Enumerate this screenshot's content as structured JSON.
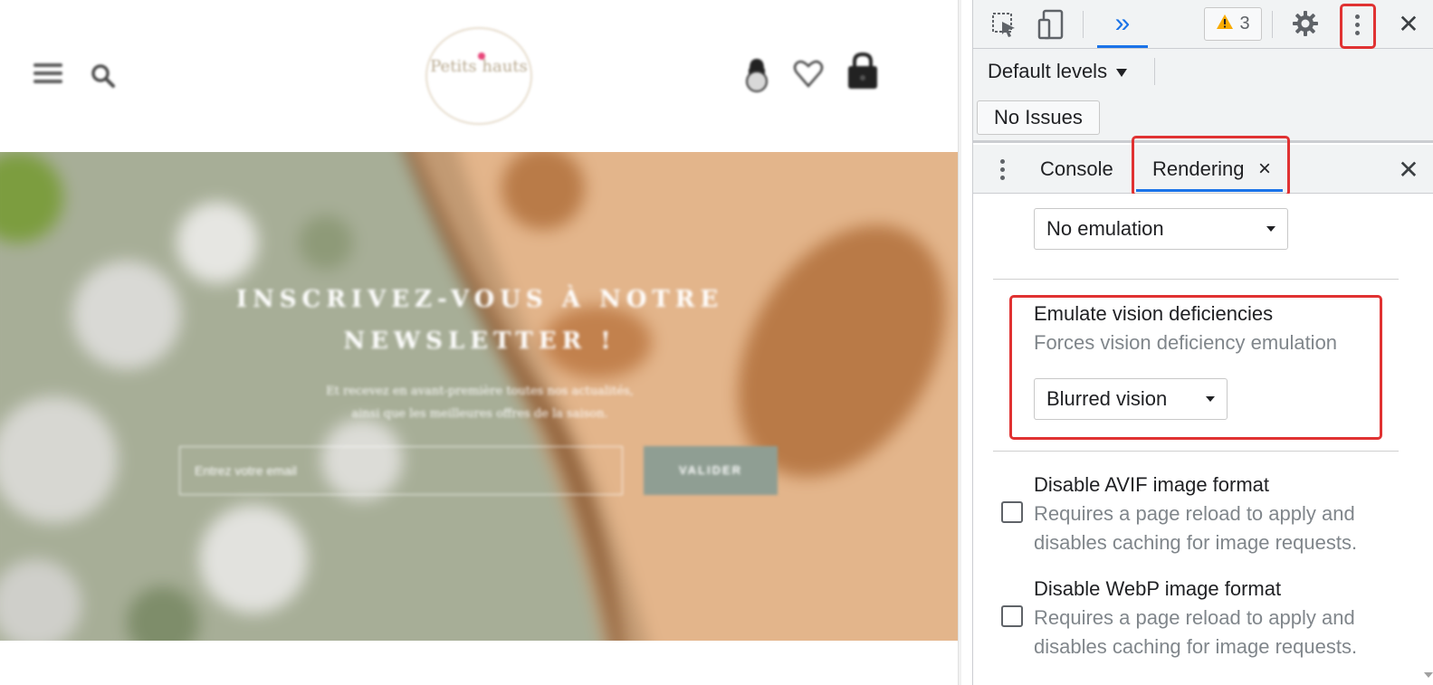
{
  "website": {
    "logo_text": "Petits hauts",
    "hero": {
      "title_line1": "INSCRIVEZ-VOUS À NOTRE",
      "title_line2": "NEWSLETTER !",
      "subtitle_line1": "Et recevez en avant-première toutes nos actualités,",
      "subtitle_line2": "ainsi que les meilleures offres de la saison.",
      "email_placeholder": "Entrez votre email",
      "submit_label": "VALIDER"
    }
  },
  "devtools": {
    "toolbar": {
      "more_tabs_glyph": "»",
      "warning_count": "3",
      "close_glyph": "✕"
    },
    "console_bar": {
      "levels_label": "Default levels",
      "issues_label": "No Issues"
    },
    "drawer": {
      "tabs": [
        {
          "label": "Console"
        },
        {
          "label": "Rendering",
          "close_glyph": "×"
        }
      ],
      "close_glyph": "✕"
    },
    "rendering": {
      "emulation_select_value": "No emulation",
      "vision": {
        "title": "Emulate vision deficiencies",
        "description": "Forces vision deficiency emulation",
        "select_value": "Blurred vision"
      },
      "avif": {
        "title": "Disable AVIF image format",
        "desc_line1": "Requires a page reload to apply and",
        "desc_line2": "disables caching for image requests."
      },
      "webp": {
        "title": "Disable WebP image format",
        "desc_line1": "Requires a page reload to apply and",
        "desc_line2": "disables caching for image requests."
      }
    }
  },
  "colors": {
    "highlight": "#e03232",
    "active_tab": "#1a73e8",
    "warning": "#f9ab00",
    "hero_button": "#8f9e93"
  },
  "icons": {
    "website": [
      "hamburger-menu-icon",
      "search-icon",
      "user-icon",
      "heart-icon",
      "shopping-bag-icon"
    ],
    "devtools": [
      "inspect-element-icon",
      "device-toolbar-icon",
      "more-tabs-icon",
      "warning-icon",
      "settings-gear-icon",
      "kebab-menu-icon",
      "close-icon"
    ]
  }
}
